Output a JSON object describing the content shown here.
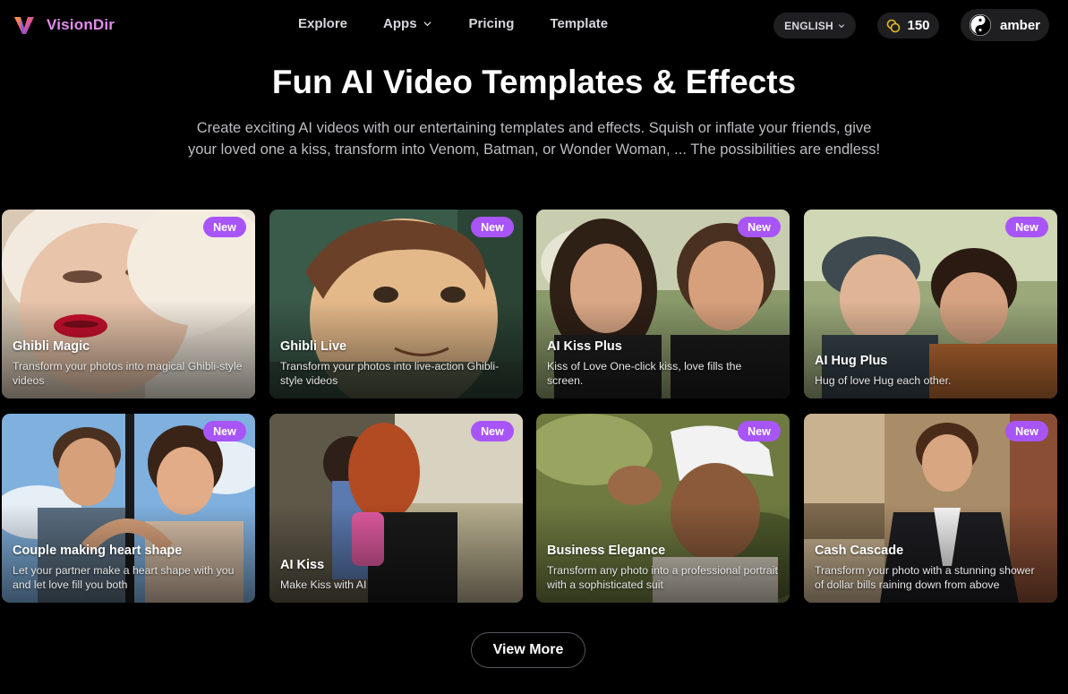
{
  "brand": {
    "name": "VisionDir",
    "accent": "#e58cf0"
  },
  "nav": {
    "explore": "Explore",
    "apps": "Apps",
    "pricing": "Pricing",
    "template": "Template"
  },
  "header": {
    "language": "ENGLISH",
    "credits": "150",
    "username": "amber"
  },
  "hero": {
    "title": "Fun AI Video Templates & Effects",
    "subtitle": "Create exciting AI videos with our entertaining templates and effects. Squish or inflate your friends, give your loved one a kiss, transform into Venom, Batman, or Wonder Woman, ... The possibilities are endless!"
  },
  "badge_color": "#a855f7",
  "cards": [
    {
      "badge": "New",
      "title": "Ghibli Magic",
      "desc": "Transform your photos into magical Ghibli-style videos"
    },
    {
      "badge": "New",
      "title": "Ghibli Live",
      "desc": "Transform your photos into live-action Ghibli-style videos"
    },
    {
      "badge": "New",
      "title": "AI Kiss Plus",
      "desc": "Kiss of Love One-click kiss, love fills the screen."
    },
    {
      "badge": "New",
      "title": "AI Hug Plus",
      "desc": "Hug of love Hug each other."
    },
    {
      "badge": "New",
      "title": "Couple making heart shape",
      "desc": "Let your partner make a heart shape with you and let love fill you both"
    },
    {
      "badge": "New",
      "title": "AI Kiss",
      "desc": "Make Kiss with AI"
    },
    {
      "badge": "New",
      "title": "Business Elegance",
      "desc": "Transform any photo into a professional portrait with a sophisticated suit"
    },
    {
      "badge": "New",
      "title": "Cash Cascade",
      "desc": "Transform your photo with a stunning shower of dollar bills raining down from above"
    }
  ],
  "view_more": "View More"
}
